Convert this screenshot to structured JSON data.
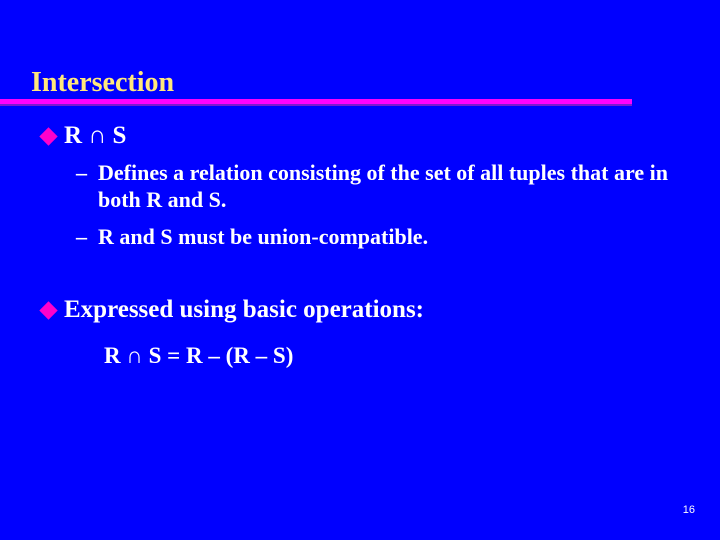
{
  "slide": {
    "title": "Intersection",
    "background_color": "#0000FF",
    "title_color": "#FFE87C",
    "rule_color": "#FF00FF",
    "rule_shadow_color": "#7A1BD0",
    "bullet_color": "#FF00CC",
    "body_text_color": "#FFFFFF",
    "slide_number": "16",
    "bullets": [
      {
        "bullet_glyph": "diamond",
        "text": "R ∩ S",
        "sub_bullets": [
          {
            "dash": "–",
            "text": "Defines a relation consisting of the set of all tuples that are in both R and S."
          },
          {
            "dash": "–",
            "text": "R and S must be union-compatible."
          }
        ]
      },
      {
        "bullet_glyph": "diamond",
        "text": "Expressed using basic operations:",
        "formula": "R ∩ S = R – (R – S)"
      }
    ]
  }
}
